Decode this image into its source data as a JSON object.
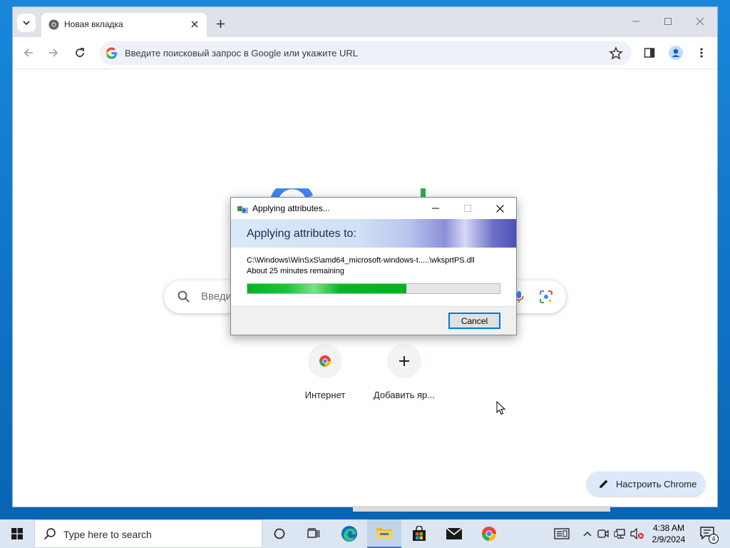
{
  "browser": {
    "tab": {
      "title": "Новая вкладка"
    },
    "omnibox": {
      "placeholder": "Введите поисковый запрос в Google или укажите URL"
    },
    "ntp": {
      "search_placeholder": "Введи",
      "shortcuts": [
        {
          "label": "Интернет",
          "icon": "chrome-logo-icon"
        },
        {
          "label": "Добавить яр...",
          "icon": "plus-icon"
        }
      ],
      "customize_label": "Настроить Chrome"
    }
  },
  "dialog": {
    "title": "Applying attributes...",
    "heading": "Applying attributes to:",
    "path": "C:\\Windows\\WinSxS\\amd64_microsoft-windows-t.....\\wksprtPS.dll",
    "remaining": "About 25 minutes remaining",
    "progress": 0.63,
    "cancel_label": "Cancel"
  },
  "taskbar": {
    "search_placeholder": "Type here to search",
    "time": "4:38 AM",
    "date": "2/9/2024",
    "notification_count": "4"
  },
  "colors": {
    "accent": "#0078d7",
    "progress_green": "#06b025",
    "desktop_blue": "#0f74c8"
  }
}
